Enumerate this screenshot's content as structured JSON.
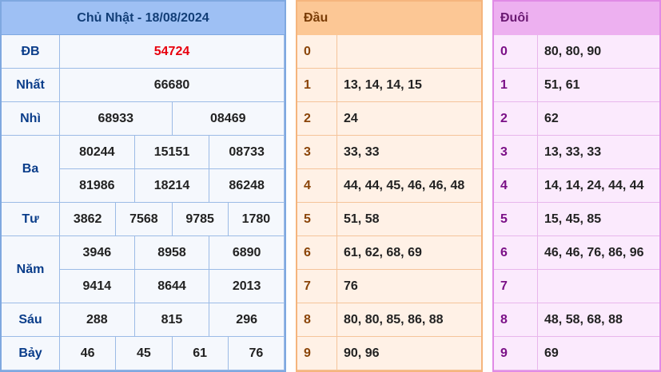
{
  "results": {
    "title": "Chủ Nhật - 18/08/2024",
    "prizes": [
      {
        "label": "ĐB",
        "rows": [
          [
            "54724"
          ]
        ]
      },
      {
        "label": "Nhất",
        "rows": [
          [
            "66680"
          ]
        ]
      },
      {
        "label": "Nhì",
        "rows": [
          [
            "68933",
            "08469"
          ]
        ]
      },
      {
        "label": "Ba",
        "rows": [
          [
            "80244",
            "15151",
            "08733"
          ],
          [
            "81986",
            "18214",
            "86248"
          ]
        ]
      },
      {
        "label": "Tư",
        "rows": [
          [
            "3862",
            "7568",
            "9785",
            "1780"
          ]
        ]
      },
      {
        "label": "Năm",
        "rows": [
          [
            "3946",
            "8958",
            "6890"
          ],
          [
            "9414",
            "8644",
            "2013"
          ]
        ]
      },
      {
        "label": "Sáu",
        "rows": [
          [
            "288",
            "815",
            "296"
          ]
        ]
      },
      {
        "label": "Bảy",
        "rows": [
          [
            "46",
            "45",
            "61",
            "76"
          ]
        ]
      }
    ],
    "special_color": "#e8000d"
  },
  "dau": {
    "header": "Đầu",
    "header_value": "",
    "rows": [
      {
        "key": "0",
        "value": ""
      },
      {
        "key": "1",
        "value": "13, 14, 14, 15"
      },
      {
        "key": "2",
        "value": "24"
      },
      {
        "key": "3",
        "value": "33, 33"
      },
      {
        "key": "4",
        "value": "44, 44, 45, 46, 46, 48"
      },
      {
        "key": "5",
        "value": "51, 58"
      },
      {
        "key": "6",
        "value": "61, 62, 68, 69"
      },
      {
        "key": "7",
        "value": "76"
      },
      {
        "key": "8",
        "value": "80, 80, 85, 86, 88"
      },
      {
        "key": "9",
        "value": "90, 96"
      }
    ],
    "color": "#fcc795"
  },
  "duoi": {
    "header": "Đuôi",
    "header_value": "",
    "rows": [
      {
        "key": "0",
        "value": "80, 80, 90"
      },
      {
        "key": "1",
        "value": "51, 61"
      },
      {
        "key": "2",
        "value": "62"
      },
      {
        "key": "3",
        "value": "13, 33, 33"
      },
      {
        "key": "4",
        "value": "14, 14, 24, 44, 44"
      },
      {
        "key": "5",
        "value": "15, 45, 85"
      },
      {
        "key": "6",
        "value": "46, 46, 76, 86, 96"
      },
      {
        "key": "7",
        "value": ""
      },
      {
        "key": "8",
        "value": "48, 58, 68, 88"
      },
      {
        "key": "9",
        "value": "69"
      }
    ],
    "color": "#edb0f0"
  }
}
